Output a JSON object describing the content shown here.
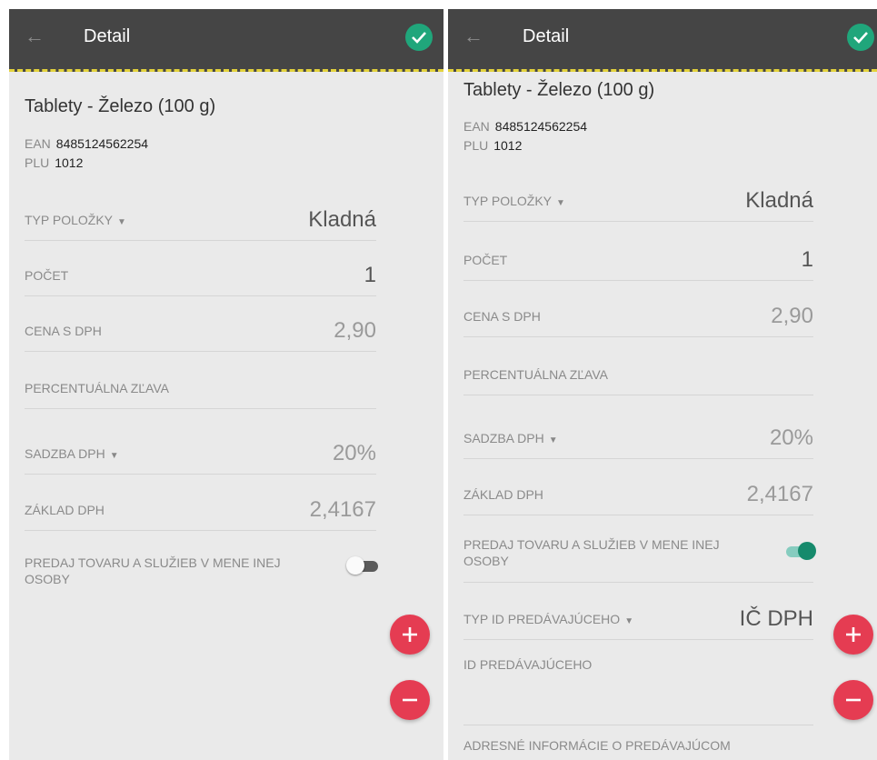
{
  "left": {
    "header": {
      "title": "Detail"
    },
    "product": {
      "name": "Tablety - Železo (100 g)",
      "ean_label": "EAN",
      "ean": "8485124562254",
      "plu_label": "PLU",
      "plu": "1012"
    },
    "fields": {
      "type": {
        "label": "TYP POLOŽKY",
        "value": "Kladná"
      },
      "count": {
        "label": "POČET",
        "value": "1"
      },
      "price": {
        "label": "CENA S DPH",
        "value": "2,90"
      },
      "discount": {
        "label": "PERCENTUÁLNA ZĽAVA",
        "value": ""
      },
      "vat_rate": {
        "label": "SADZBA DPH",
        "value": "20%"
      },
      "vat_base": {
        "label": "ZÁKLAD DPH",
        "value": "2,4167"
      }
    },
    "toggle": {
      "label": "PREDAJ TOVARU A SLUŽIEB V MENE INEJ OSOBY",
      "on": false
    }
  },
  "right": {
    "header": {
      "title": "Detail"
    },
    "product": {
      "name": "Tablety - Železo (100 g)",
      "ean_label": "EAN",
      "ean": "8485124562254",
      "plu_label": "PLU",
      "plu": "1012"
    },
    "fields": {
      "type": {
        "label": "TYP POLOŽKY",
        "value": "Kladná"
      },
      "count": {
        "label": "POČET",
        "value": "1"
      },
      "price": {
        "label": "CENA S DPH",
        "value": "2,90"
      },
      "discount": {
        "label": "PERCENTUÁLNA ZĽAVA",
        "value": ""
      },
      "vat_rate": {
        "label": "SADZBA DPH",
        "value": "20%"
      },
      "vat_base": {
        "label": "ZÁKLAD DPH",
        "value": "2,4167"
      },
      "seller_id_type": {
        "label": "TYP ID PREDÁVAJÚCEHO",
        "value": "IČ DPH"
      },
      "seller_id": {
        "label": "ID PREDÁVAJÚCEHO",
        "value": ""
      },
      "seller_address": {
        "label": "ADRESNÉ INFORMÁCIE O PREDÁVAJÚCOM"
      }
    },
    "toggle": {
      "label": "PREDAJ TOVARU A SLUŽIEB V MENE INEJ OSOBY",
      "on": true
    }
  },
  "icons": {
    "back": "arrow-back-icon",
    "confirm": "check-icon",
    "add": "plus-icon",
    "remove": "minus-icon",
    "dropdown": "caret-down-icon"
  },
  "colors": {
    "appbar": "#454545",
    "accent_stripe": "#e3d23c",
    "confirm": "#20a67b",
    "fab": "#e53c52",
    "toggle_on": "#168a6c"
  }
}
